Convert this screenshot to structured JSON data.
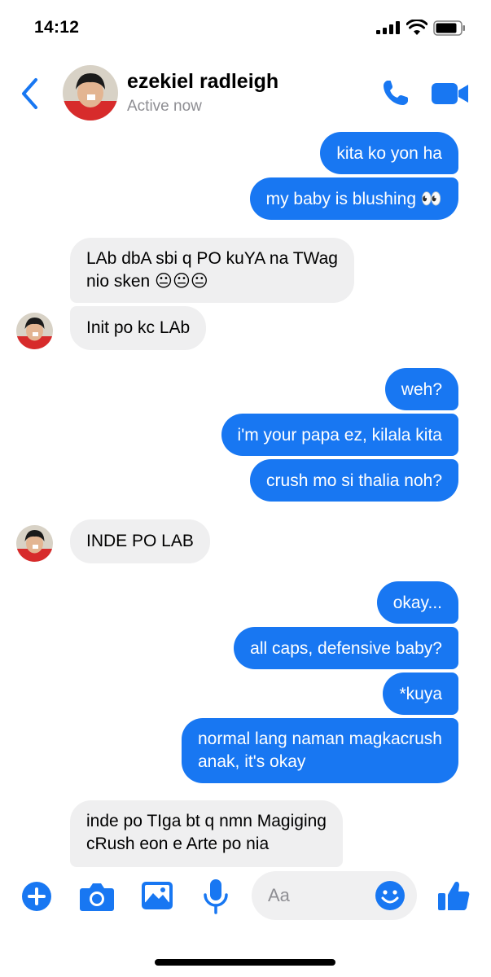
{
  "status_bar": {
    "time": "14:12"
  },
  "header": {
    "name": "ezekiel radleigh",
    "status": "Active now",
    "back_icon": "chevron-left-icon",
    "call_icon": "phone-icon",
    "video_icon": "video-camera-icon"
  },
  "messages": [
    {
      "from": "me",
      "text": "kita ko yon ha"
    },
    {
      "from": "me",
      "text": "my baby is blushing 👀"
    },
    {
      "from": "them",
      "line1": "LAb dbA sbi q PO kuYA na TWag",
      "line2": "nio sken 😐😐😐"
    },
    {
      "from": "them",
      "text": "Init po kc LAb"
    },
    {
      "from": "me",
      "text": "weh?"
    },
    {
      "from": "me",
      "text": "i'm your papa ez, kilala kita"
    },
    {
      "from": "me",
      "text": "crush mo si thalia noh?"
    },
    {
      "from": "them",
      "text": "INDE PO LAB"
    },
    {
      "from": "me",
      "text": "okay..."
    },
    {
      "from": "me",
      "text": "all caps, defensive baby?"
    },
    {
      "from": "me",
      "text": "*kuya"
    },
    {
      "from": "me",
      "line1": "normal lang naman magkacrush",
      "line2": "anak, it's okay"
    },
    {
      "from": "them",
      "line1": "inde po TIga bt q nmn Magiging",
      "line2": "cRush eon e Arte po nia"
    }
  ],
  "composer": {
    "placeholder": "Aa",
    "icons": [
      "plus-icon",
      "camera-icon",
      "image-icon",
      "microphone-icon",
      "emoji-icon",
      "thumbs-up-icon"
    ]
  },
  "colors": {
    "accent": "#1877f2",
    "incoming_bubble": "#efeff0",
    "muted_text": "#8e8e93"
  }
}
